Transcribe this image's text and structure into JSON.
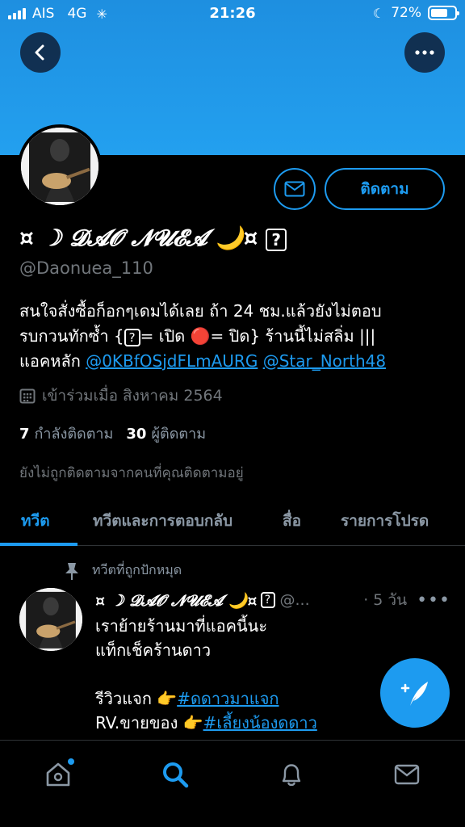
{
  "status_bar": {
    "carrier": "AIS",
    "network": "4G",
    "time": "21:26",
    "battery_percent": "72%",
    "battery_level": 0.72
  },
  "profile": {
    "display_name": "¤ ☽ 𝓓𝓐𝓞 𝓝𝓤𝓔𝓐 🌙¤",
    "handle": "@Daonuea_110",
    "bio_line1": "สนใจสั่งซื้อก็อกๆเดมได้เลย ถ้า 24 ชม.แล้วยังไม่ตอบ",
    "bio_line2_a": "รบกวนทักซ้ำ {",
    "bio_line2_b": "= เปิด 🔴= ปิด} ร้านนี้ไม่สลิ่ม |||",
    "bio_line3_prefix": "แอคหลัก ",
    "bio_link1": "@0KBfOSjdFLmAURG",
    "bio_link2": "@Star_North48",
    "question_glyph": "?",
    "joined": "เข้าร่วมเมื่อ สิงหาคม 2564",
    "following_count": "7",
    "following_label": "กำลังติดตาม",
    "followers_count": "30",
    "followers_label": "ผู้ติดตาม",
    "not_followed": "ยังไม่ถูกติดตามจากคนที่คุณติดตามอยู่",
    "follow_button": "ติดตาม"
  },
  "tabs": [
    {
      "label": "ทวีต",
      "active": true
    },
    {
      "label": "ทวีตและการตอบกลับ",
      "active": false
    },
    {
      "label": "สื่อ",
      "active": false
    },
    {
      "label": "รายการโปรด",
      "active": false
    }
  ],
  "tweet": {
    "pinned_label": "ทวีตที่ถูกปักหมุด",
    "author_name": "¤ ☽ 𝓓𝓐𝓞 𝓝𝓤𝓔𝓐 🌙¤",
    "author_handle": "@...",
    "time": "· 5 วัน",
    "line1": "เราย้ายร้านมาที่แอคนี้นะ",
    "line2": "แท็กเช็คร้านดาว",
    "line3_prefix": "รีวิวแจก 👉",
    "line3_tag": "#ดดาวมาแจก",
    "line4_prefix": "RV.ขายของ 👉",
    "line4_tag": "#เลี้ยงน้องดดาว"
  },
  "colors": {
    "accent": "#1d9bf0",
    "header": "#23a0ef",
    "background": "#000000",
    "muted": "#71767b"
  }
}
